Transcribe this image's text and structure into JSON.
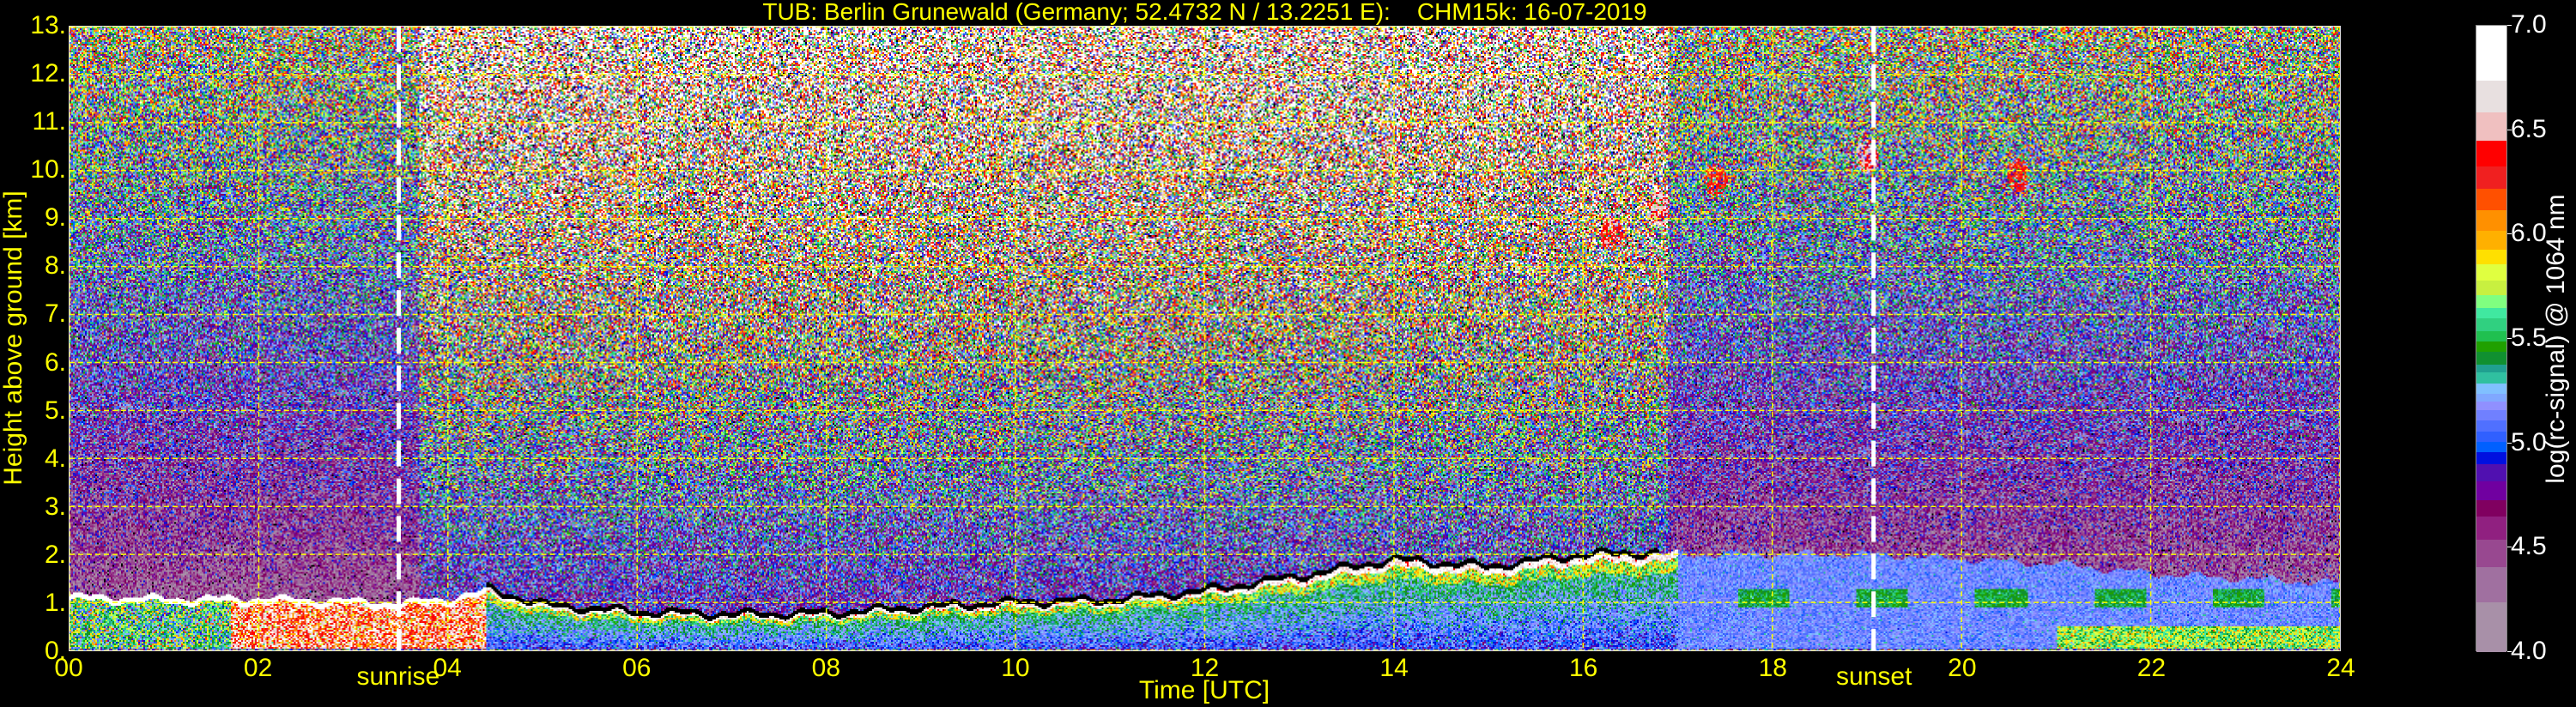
{
  "chart_data": {
    "type": "heatmap",
    "title": "TUB: Berlin Grunewald (Germany; 52.4732 N / 13.2251 E):    CHM15k: 16-07-2019",
    "xlabel": "Time [UTC]",
    "ylabel": "Height above ground [km]",
    "xlim": [
      0,
      24
    ],
    "ylim": [
      0,
      13
    ],
    "grid": true,
    "xticks": [
      0,
      2,
      4,
      6,
      8,
      10,
      12,
      14,
      16,
      18,
      20,
      22,
      24
    ],
    "xtick_labels": [
      "00",
      "02",
      "04",
      "06",
      "08",
      "10",
      "12",
      "14",
      "16",
      "18",
      "20",
      "22",
      "24"
    ],
    "yticks": [
      0,
      1,
      2,
      3,
      4,
      5,
      6,
      7,
      8,
      9,
      10,
      11,
      12,
      13
    ],
    "ytick_labels": [
      "0.",
      "1.",
      "2.",
      "3.",
      "4.",
      "5.",
      "6.",
      "7.",
      "8.",
      "9.",
      "10.",
      "11.",
      "12.",
      "13."
    ],
    "annotations": [
      {
        "label": "sunrise",
        "time_h": 3.48
      },
      {
        "label": "sunset",
        "time_h": 19.07
      }
    ],
    "boundary_layer_top_km": {
      "time_h": [
        0,
        1,
        2,
        3,
        3.5,
        4,
        4.4,
        5,
        6,
        7,
        8,
        9,
        10,
        11,
        12,
        13,
        14,
        15,
        16,
        17,
        18,
        19,
        20,
        21,
        22,
        23,
        24
      ],
      "height_km": [
        1.15,
        1.1,
        1.1,
        1.05,
        1.0,
        1.1,
        1.25,
        0.9,
        0.75,
        0.7,
        0.72,
        0.85,
        0.95,
        1.0,
        1.2,
        1.5,
        1.85,
        1.7,
        1.95,
        2.0,
        2.0,
        2.0,
        1.9,
        1.8,
        1.6,
        1.5,
        1.4
      ]
    },
    "cloud_features": [
      {
        "time_h": 16.3,
        "height_km": 8.7,
        "value": 6.4
      },
      {
        "time_h": 16.8,
        "height_km": 9.2,
        "value": 6.5
      },
      {
        "time_h": 17.4,
        "height_km": 9.8,
        "value": 6.3
      },
      {
        "time_h": 19.0,
        "height_km": 10.3,
        "value": 6.5
      },
      {
        "time_h": 20.6,
        "height_km": 9.9,
        "value": 6.3
      }
    ],
    "colorbar": {
      "label": "log(rc-signal) @ 1064 nm",
      "range": [
        4.0,
        7.0
      ],
      "ticks": [
        4.0,
        4.5,
        5.0,
        5.5,
        6.0,
        6.5,
        7.0
      ],
      "tick_labels": [
        "4.0",
        "4.5",
        "5.0",
        "5.5",
        "6.0",
        "6.5",
        "7.0"
      ],
      "levels": [
        4.0,
        4.24,
        4.41,
        4.54,
        4.65,
        4.73,
        4.82,
        4.9,
        4.96,
        5.01,
        5.06,
        5.11,
        5.16,
        5.2,
        5.24,
        5.29,
        5.34,
        5.38,
        5.44,
        5.49,
        5.54,
        5.6,
        5.65,
        5.71,
        5.78,
        5.86,
        5.93,
        6.02,
        6.12,
        6.22,
        6.33,
        6.45,
        6.585,
        6.74,
        7.0
      ],
      "colors": [
        "#a890a8",
        "#a070a0",
        "#984890",
        "#902080",
        "#800060",
        "#7000a0",
        "#5010b0",
        "#0010e0",
        "#0060ff",
        "#3060ff",
        "#5070ff",
        "#7080ff",
        "#9090ff",
        "#80a8ff",
        "#80c0ff",
        "#30c0a0",
        "#20a090",
        "#109030",
        "#20a000",
        "#20c050",
        "#30d080",
        "#40e8a0",
        "#80ff80",
        "#c8f040",
        "#e0ff40",
        "#ffe000",
        "#ffb000",
        "#ff9000",
        "#ff5000",
        "#f02020",
        "#ff0000",
        "#f0c0c0",
        "#e8e0e0",
        "#ffffff"
      ]
    }
  },
  "colors": {
    "axis_text": "#ffff00",
    "grid": "#ffff00",
    "colorbar_text": "#ffffff",
    "marker_line": "#ffffff"
  }
}
